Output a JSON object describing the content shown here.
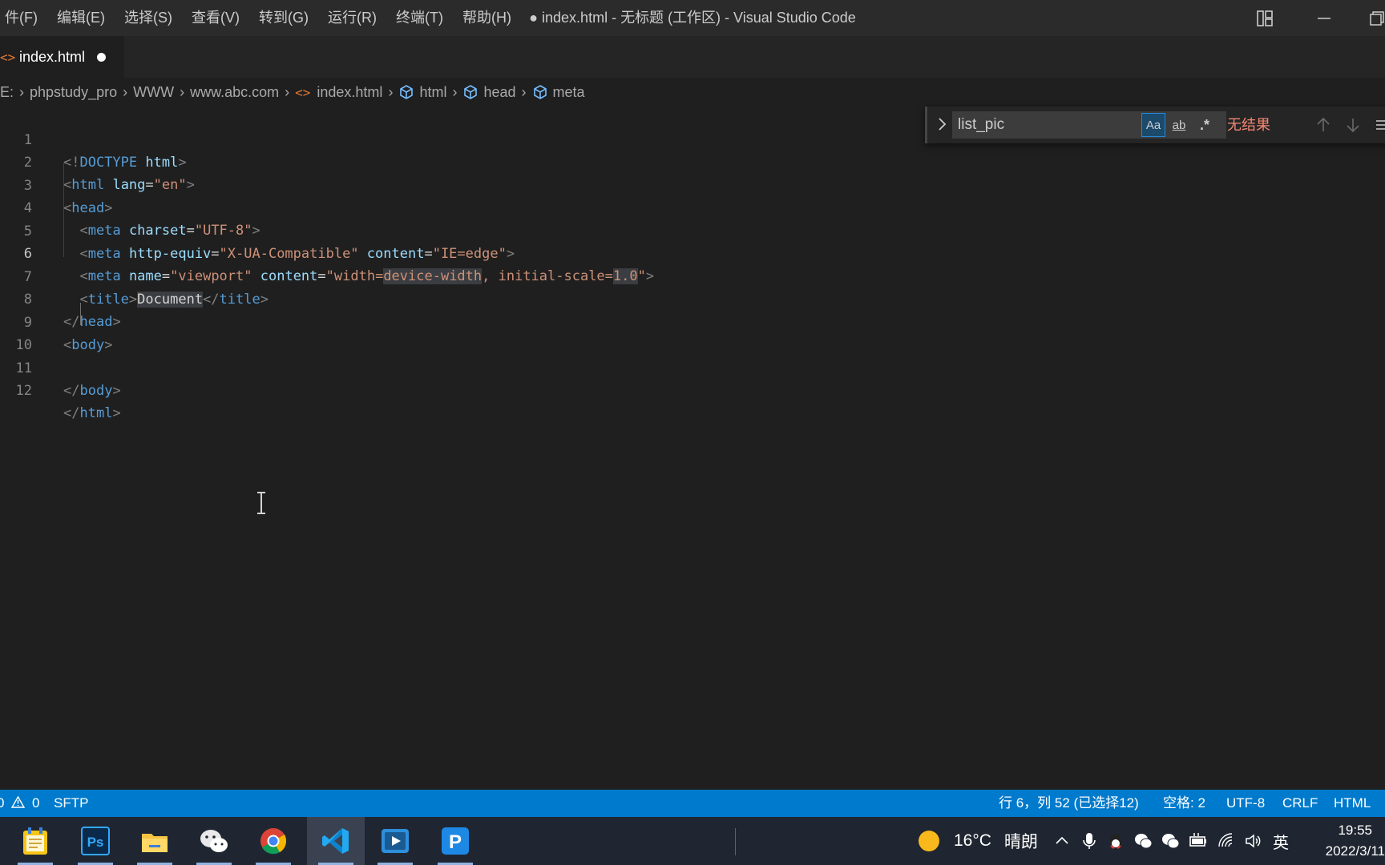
{
  "menu": [
    "件(F)",
    "编辑(E)",
    "选择(S)",
    "查看(V)",
    "转到(G)",
    "运行(R)",
    "终端(T)",
    "帮助(H)"
  ],
  "window_title": "● index.html - 无标题 (工作区) - Visual Studio Code",
  "tab": {
    "label": "index.html",
    "modified": true
  },
  "breadcrumb": [
    "E:",
    "phpstudy_pro",
    "WWW",
    "www.abc.com",
    "index.html",
    "html",
    "head",
    "meta"
  ],
  "find": {
    "value": "list_pic",
    "match_case": "Aa",
    "whole_word": "ab",
    "regex": ".*",
    "result": "无结果"
  },
  "editor": {
    "language": "HTML",
    "active_line": 6,
    "lines": [
      {
        "n": "1"
      },
      {
        "n": "2"
      },
      {
        "n": "3"
      },
      {
        "n": "4"
      },
      {
        "n": "5"
      },
      {
        "n": "6"
      },
      {
        "n": "7"
      },
      {
        "n": "8"
      },
      {
        "n": "9"
      },
      {
        "n": "10"
      },
      {
        "n": "11"
      },
      {
        "n": "12"
      }
    ],
    "code": {
      "doctype": "DOCTYPE",
      "html_tag": "html",
      "head_tag": "head",
      "meta_tag": "meta",
      "title_tag": "title",
      "body_tag": "body",
      "lang_attr": "lang",
      "lang_val": "\"en\"",
      "charset_attr": "charset",
      "charset_val": "\"UTF-8\"",
      "httpequiv_attr": "http-equiv",
      "httpequiv_val": "\"X-UA-Compatible\"",
      "content_attr": "content",
      "content_val": "\"IE=edge\"",
      "name_attr": "name",
      "name_val": "\"viewport\"",
      "viewport_pre": "\"width=",
      "viewport_sel": "device-width",
      "viewport_mid": ", initial-scale=",
      "viewport_num": "1.0",
      "viewport_end": "\"",
      "title_text": "Document"
    }
  },
  "status": {
    "errors": "0",
    "warnings": "0",
    "sftp": "SFTP",
    "position": "行 6，列 52 (已选择12)",
    "spaces": "空格: 2",
    "encoding": "UTF-8",
    "eol": "CRLF",
    "language": "HTML"
  },
  "taskbar": {
    "weather_temp": "16°C",
    "weather_text": "晴朗",
    "ime": "英",
    "time": "19:55",
    "date": "2022/3/11"
  },
  "colors": {
    "accent": "#007acc",
    "tag": "#569cd6",
    "attr": "#9cdcfe",
    "string": "#ce9178",
    "find_no_result": "#f48771"
  }
}
